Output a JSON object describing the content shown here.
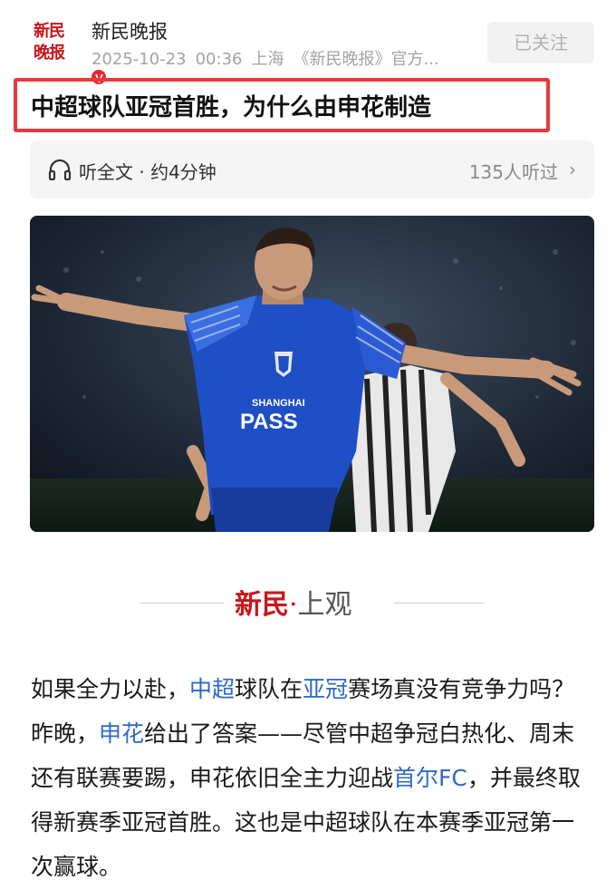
{
  "account": {
    "logo_line1": "新民",
    "logo_line2": "晚报",
    "verified_badge": "V",
    "name": "新民晚报",
    "date": "2025-10-23",
    "time": "00:36",
    "location": "上海",
    "source": "《新民晚报》官方..."
  },
  "follow_button": "已关注",
  "article": {
    "title": "中超球队亚冠首胜，为什么由申花制造"
  },
  "listen": {
    "icon": "headphones-icon",
    "label": "听全文 · 约4分钟",
    "count": "135人听过",
    "chevron": "›"
  },
  "photo": {
    "shirt_text_1": "SHANGHAI",
    "shirt_text_2": "PASS"
  },
  "brand": {
    "main": "新民",
    "dot": "·",
    "sub": "上观"
  },
  "paragraph": {
    "s1": "如果全力以赴，",
    "l1": "中超",
    "s2": "球队在",
    "l2": "亚冠",
    "s3": "赛场真没有竞争力吗？昨晚，",
    "l3": "申花",
    "s4": "给出了答案——尽管中超争冠白热化、周末还有联赛要踢，申花依旧全主力迎战",
    "l4": "首尔FC",
    "s5": "，并最终取得新赛季亚冠首胜。这也是中超球队在本赛季亚冠第一次赢球。"
  },
  "colors": {
    "brand_red": "#c8161d",
    "title_highlight": "#e8393c",
    "link_blue": "#2f6ac4",
    "jersey_blue": "#1f4fc4"
  }
}
